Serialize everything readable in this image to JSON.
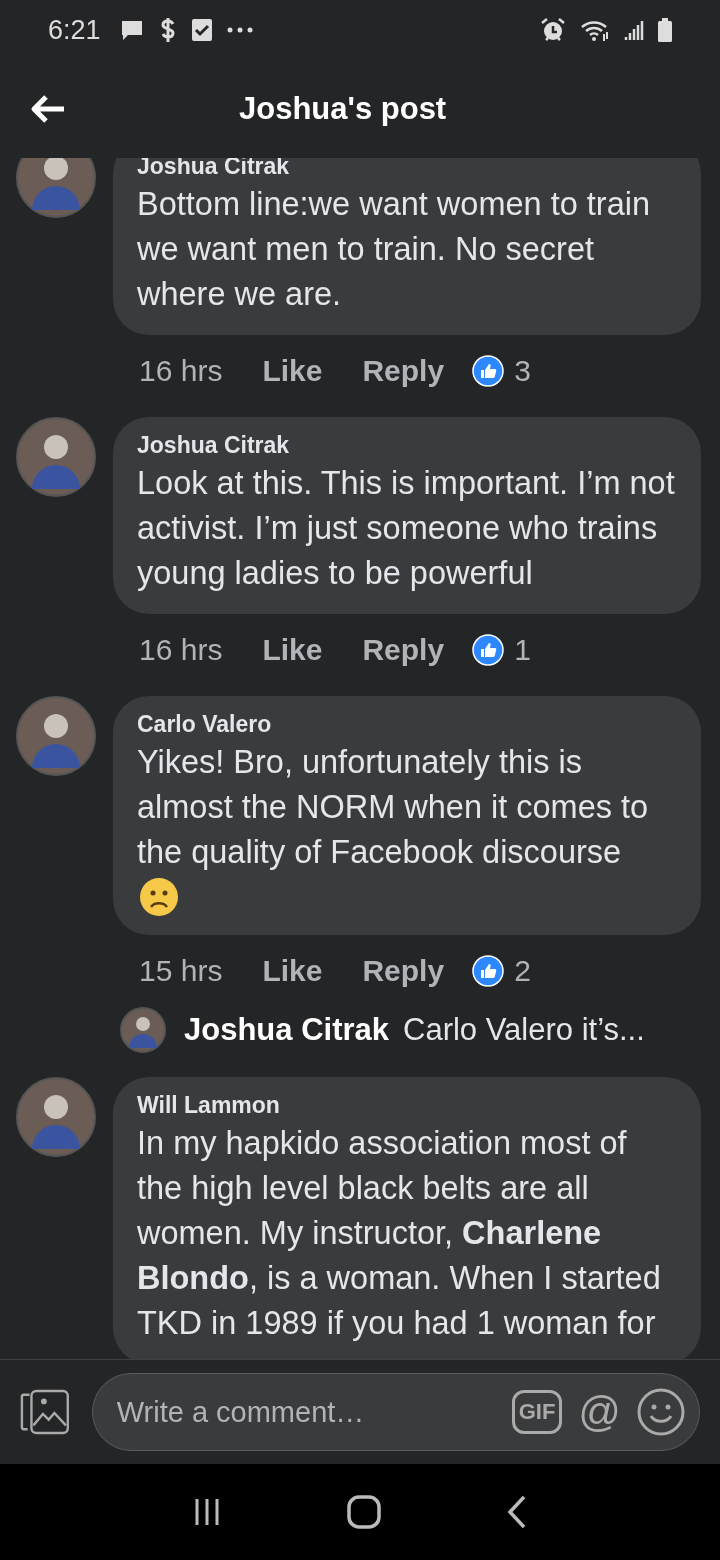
{
  "status_bar": {
    "time": "6:21"
  },
  "header": {
    "title": "Joshua's post"
  },
  "comments": [
    {
      "author": "Joshua Citrak",
      "text": "Bottom line:we want women to train we want men to train. No secret where we are.",
      "emoji": false,
      "time": "16 hrs",
      "like": "Like",
      "reply": "Reply",
      "reactions": "3"
    },
    {
      "author": "Joshua Citrak",
      "text": "Look at this. This is important. I’m not activist. I’m just someone who trains young ladies to be powerful",
      "emoji": false,
      "time": "16 hrs",
      "like": "Like",
      "reply": "Reply",
      "reactions": "1"
    },
    {
      "author": "Carlo Valero",
      "text": "Yikes! Bro, unfortunately this is almost the NORM when it comes to the quality of Facebook discourse",
      "emoji": true,
      "time": "15 hrs",
      "like": "Like",
      "reply": "Reply",
      "reactions": "2",
      "replies": [
        {
          "author": "Joshua Citrak",
          "text": "Carlo Valero it’s..."
        }
      ]
    },
    {
      "author": "Will Lammon",
      "text": "In my hapkido association most of the high level black belts are all women. My instructor, **Charlene Blondo**, is a woman.  When I started TKD in 1989 if you had 1 woman for",
      "emoji": false
    }
  ],
  "composer": {
    "placeholder": "Write a comment…",
    "gif": "GIF",
    "mention": "@"
  }
}
